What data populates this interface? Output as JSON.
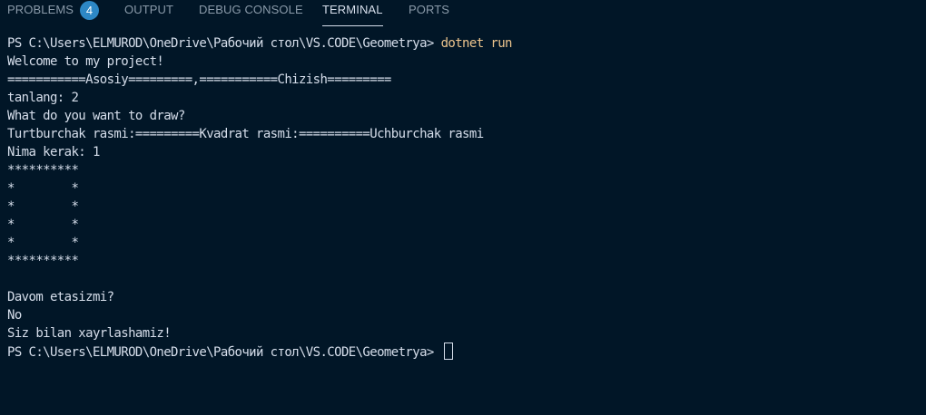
{
  "tabs": {
    "problems": "PROBLEMS",
    "problems_count": "4",
    "output": "OUTPUT",
    "debug_console": "DEBUG CONSOLE",
    "terminal": "TERMINAL",
    "ports": "PORTS",
    "active": "TERMINAL"
  },
  "terminal": {
    "prompt_1": "PS C:\\Users\\ELMUROD\\OneDrive\\Рабочий стол\\VS.CODE\\Geometrya> ",
    "command_1": "dotnet run",
    "lines": [
      "Welcome to my project!",
      "===========Asosiy=========,===========Chizish=========",
      "tanlang: 2",
      "What do you want to draw?",
      "Turtburchak rasmi:=========Kvadrat rasmi:==========Uchburchak rasmi",
      "Nima kerak: 1",
      "**********",
      "*        *",
      "*        *",
      "*        *",
      "*        *",
      "**********",
      "",
      "Davom etasizmi?",
      "No",
      "Siz bilan xayrlashamiz!"
    ],
    "prompt_2": "PS C:\\Users\\ELMUROD\\OneDrive\\Рабочий стол\\VS.CODE\\Geometrya> "
  },
  "colors": {
    "background": "#011627",
    "text": "#d6deeb",
    "command": "#ecc48d",
    "badge": "#2d88c6",
    "inactive_tab": "#8a9aa9"
  }
}
